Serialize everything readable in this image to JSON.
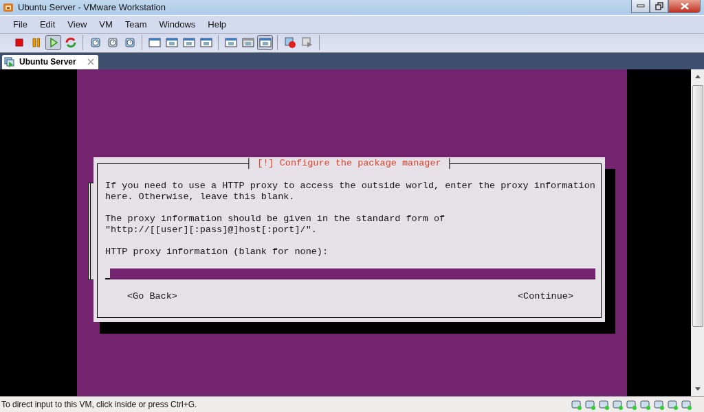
{
  "window": {
    "title": "Ubuntu Server - VMware Workstation"
  },
  "menu": [
    "File",
    "Edit",
    "View",
    "VM",
    "Team",
    "Windows",
    "Help"
  ],
  "toolbar": [
    [
      {
        "kind": "stop",
        "pressed": false
      },
      {
        "kind": "pause",
        "pressed": false
      },
      {
        "kind": "play",
        "pressed": true
      },
      {
        "kind": "reset",
        "pressed": false
      }
    ],
    [
      {
        "kind": "snapshot",
        "pressed": false
      },
      {
        "kind": "revert",
        "pressed": false
      },
      {
        "kind": "snapshot-manager",
        "pressed": false
      }
    ],
    [
      {
        "kind": "sidebar",
        "pressed": false
      },
      {
        "kind": "fullscreen",
        "pressed": false
      },
      {
        "kind": "unity",
        "pressed": false
      },
      {
        "kind": "multi-window",
        "pressed": false
      }
    ],
    [
      {
        "kind": "settings",
        "pressed": false
      },
      {
        "kind": "console",
        "pressed": false
      },
      {
        "kind": "quick-switch",
        "pressed": true
      }
    ],
    [
      {
        "kind": "record",
        "pressed": false
      },
      {
        "kind": "replay",
        "pressed": false
      }
    ]
  ],
  "tabs": [
    {
      "label": "Ubuntu Server",
      "selected": true
    }
  ],
  "dialog": {
    "title": "[!] Configure the package manager",
    "paragraphs": [
      [
        "If you need to use a HTTP proxy to access the outside world, enter the proxy information",
        "here. Otherwise, leave this blank."
      ],
      [
        "The proxy information should be given in the standard form of",
        "\"http://[[user][:pass]@]host[:port]/\"."
      ],
      [
        "HTTP proxy information (blank for none):"
      ]
    ],
    "buttons": [
      "<Go Back>",
      "<Continue>"
    ]
  },
  "status_bar": {
    "text": "To direct input to this VM, click inside or press Ctrl+G."
  }
}
